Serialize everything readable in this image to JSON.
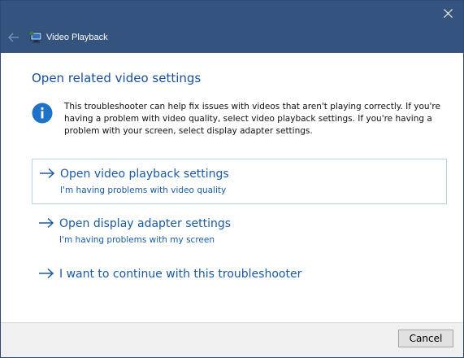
{
  "window": {
    "title": "Video Playback",
    "titlebar_color": "#34537f"
  },
  "page": {
    "heading": "Open related video settings",
    "info_text": "This troubleshooter can help fix issues with videos that aren't playing correctly. If you're having a problem with video quality, select video playback settings. If you're having a problem with your screen, select display adapter settings."
  },
  "options": [
    {
      "title": "Open video playback settings",
      "subtitle": "I'm having problems with video quality",
      "selected": true
    },
    {
      "title": "Open display adapter settings",
      "subtitle": "I'm having problems with my screen",
      "selected": false
    },
    {
      "title": "I want to continue with this troubleshooter",
      "subtitle": "",
      "selected": false
    }
  ],
  "footer": {
    "cancel_label": "Cancel"
  },
  "icons": {
    "close": "close-icon",
    "back": "back-arrow-icon",
    "app": "video-playback-icon",
    "info": "info-icon",
    "option_arrow": "arrow-right-icon"
  },
  "colors": {
    "link": "#1a5aa0",
    "heading": "#1a4fa0",
    "info_icon": "#1e73c8"
  }
}
